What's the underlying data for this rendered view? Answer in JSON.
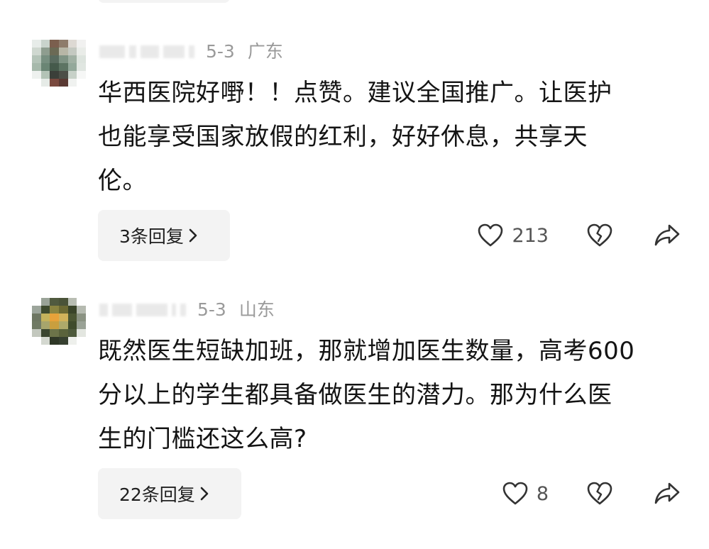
{
  "comments": [
    {
      "date": "5-3",
      "region": "广东",
      "text": "华西医院好嘢！！点赞。建议全国推广。让医护也能享受国家放假的红利，好好休息，共享天伦。",
      "lines": [
        "华西医院好嘢！！点赞。建议全国推广。让医护",
        "也能享受国家放假的红利，好好休息，共享天",
        "伦。"
      ],
      "reply_label": "3条回复",
      "like_count": "213",
      "avatar_icon": "avatar-icon",
      "like_icon": "heart-icon",
      "dislike_icon": "broken-heart-icon",
      "share_icon": "share-icon"
    },
    {
      "date": "5-3",
      "region": "山东",
      "text": "既然医生短缺加班，那就增加医生数量，高考600分以上的学生都具备做医生的潜力。那为什么医生的门槛还这么高?",
      "lines": [
        "既然医生短缺加班，那就增加医生数量，高考600",
        "分以上的学生都具备做医生的潜力。那为什么医",
        "生的门槛还这么高?"
      ],
      "reply_label": "22条回复",
      "like_count": "8",
      "avatar_icon": "avatar-icon",
      "like_icon": "heart-icon",
      "dislike_icon": "broken-heart-icon",
      "share_icon": "share-icon"
    }
  ],
  "colors": {
    "text": "#141414",
    "meta": "#9a9a9a",
    "button_bg": "#f3f3f3",
    "icon": "#333333"
  }
}
